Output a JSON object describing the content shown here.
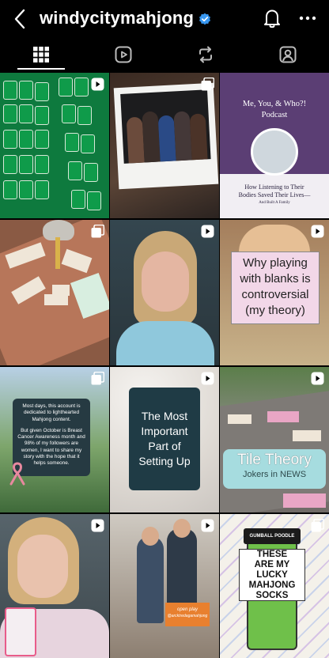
{
  "header": {
    "username": "windycitymahjong"
  },
  "tabs": [
    {
      "icon": "grid-icon",
      "active": true
    },
    {
      "icon": "reels-icon",
      "active": false
    },
    {
      "icon": "reposts-icon",
      "active": false
    },
    {
      "icon": "tagged-icon",
      "active": false
    }
  ],
  "posts": {
    "podcast": {
      "title_line1": "Me, You, & Who?!",
      "title_line2": "Podcast",
      "subtitle_line1": "How Listening to Their",
      "subtitle_line2": "Bodies Saved Their Lives—",
      "subtitle_line3": "And Built A Family"
    },
    "blanks": {
      "line1": "Why playing",
      "line2": "with blanks is",
      "line3": "controversial",
      "line4": "(my theory)"
    },
    "awareness": {
      "line1": "Most days, this account is",
      "line2": "dedicated to lighthearted",
      "line3": "Mahjong content.",
      "line4": "But given October is Breast",
      "line5": "Cancer Awareness month and",
      "line6": "98% of my followers are",
      "line7": "women, I want to share my",
      "line8": "story with the hope that it",
      "line9": "helps someone."
    },
    "setting_up": {
      "line1": "The Most",
      "line2": "Important",
      "line3": "Part of",
      "line4": "Setting Up"
    },
    "tile_theory": {
      "title": "Tile Theory",
      "subtitle": "Jokers in NEWS"
    },
    "socks": {
      "brand": "GUMBALL POODLE",
      "line1": "THESE",
      "line2": "ARE MY",
      "line3": "LUCKY",
      "line4": "MAHJONG",
      "line5": "SOCKS"
    },
    "event": {
      "tag1": "open play",
      "tag2": "@arcktredagamahjong"
    }
  },
  "colors": {
    "background": "#000000",
    "verified": "#3897f0"
  }
}
